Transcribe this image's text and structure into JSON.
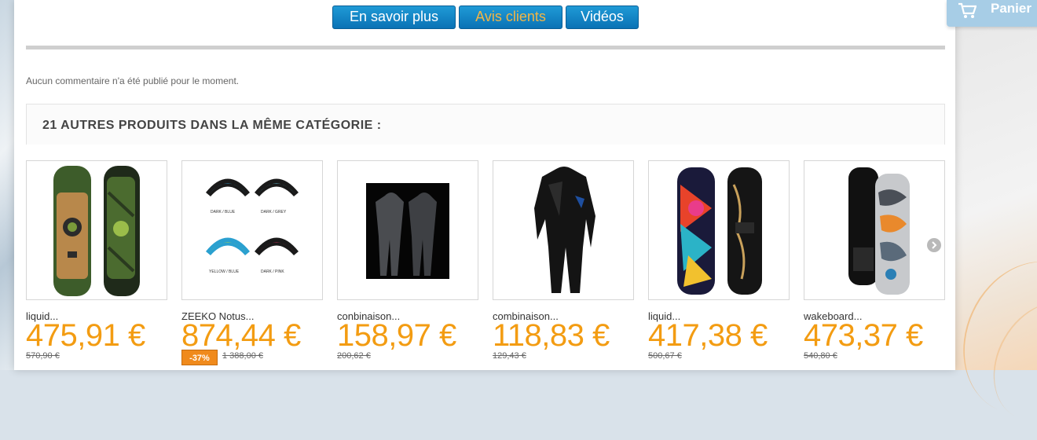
{
  "cart": {
    "label": "Panier"
  },
  "tabs": [
    {
      "label": "En savoir plus",
      "active": false
    },
    {
      "label": "Avis clients",
      "active": true
    },
    {
      "label": "Vidéos",
      "active": false
    }
  ],
  "reviews": {
    "empty_message": "Aucun commentaire n'a été publié pour le moment."
  },
  "related": {
    "title": "21 AUTRES PRODUITS DANS LA MÊME CATÉGORIE :",
    "products": [
      {
        "name": "liquid...",
        "price": "475,91 €",
        "old_price": "570,90 €"
      },
      {
        "name": "ZEEKO Notus...",
        "price": "874,44 €",
        "old_price": "1 388,00 €",
        "discount": "-37%"
      },
      {
        "name": "conbinaison...",
        "price": "158,97 €",
        "old_price": "200,62 €"
      },
      {
        "name": "combinaison...",
        "price": "118,83 €",
        "old_price": "129,43 €"
      },
      {
        "name": "liquid...",
        "price": "417,38 €",
        "old_price": "500,67 €"
      },
      {
        "name": "wakeboard...",
        "price": "473,37 €",
        "old_price": "540,80 €"
      }
    ],
    "kite_labels": [
      "DARK / BLUE",
      "DARK / GREY",
      "YELLOW / BLUE",
      "DARK / PINK"
    ]
  }
}
